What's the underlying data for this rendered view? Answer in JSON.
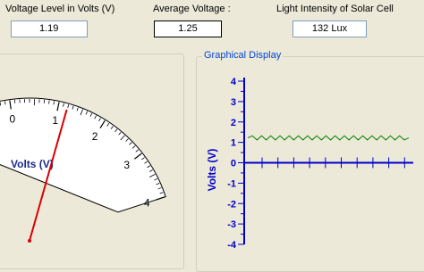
{
  "top": {
    "voltage_label": "Voltage Level in Volts (V)",
    "voltage_value": "1.19",
    "average_label": "Average Voltage :",
    "average_value": "1.25",
    "light_label": "Light Intensity of Solar Cell",
    "light_value": "132 Lux"
  },
  "meter": {
    "unit_label": "Volts (V)",
    "min": -1,
    "max": 4,
    "reading": 1.19,
    "scale_labels": [
      "0",
      "1",
      "2",
      "3",
      "4"
    ],
    "needle_color": "#dd0000"
  },
  "graph": {
    "legend": "Graphical Display",
    "ylabel": "Volts (V)",
    "y_tick_labels": [
      "4",
      "3",
      "2",
      "1",
      "0",
      "-1",
      "-2",
      "-3",
      "-4"
    ],
    "colors": {
      "axis": "#0000cc",
      "signal": "#008000"
    }
  },
  "chart_data": {
    "type": "line",
    "title": "",
    "xlabel": "",
    "ylabel": "Volts (V)",
    "ylim": [
      -4,
      4
    ],
    "grid": false,
    "series": [
      {
        "values": [
          1.22,
          1.32,
          1.12,
          1.32,
          1.12,
          1.32,
          1.12,
          1.32,
          1.12,
          1.32,
          1.12,
          1.32,
          1.12,
          1.32,
          1.12,
          1.32,
          1.12,
          1.32,
          1.12,
          1.32,
          1.12,
          1.32,
          1.12,
          1.32,
          1.12,
          1.32,
          1.12,
          1.32,
          1.12,
          1.32,
          1.12,
          1.32,
          1.12,
          1.32,
          1.12,
          1.22
        ]
      }
    ]
  }
}
